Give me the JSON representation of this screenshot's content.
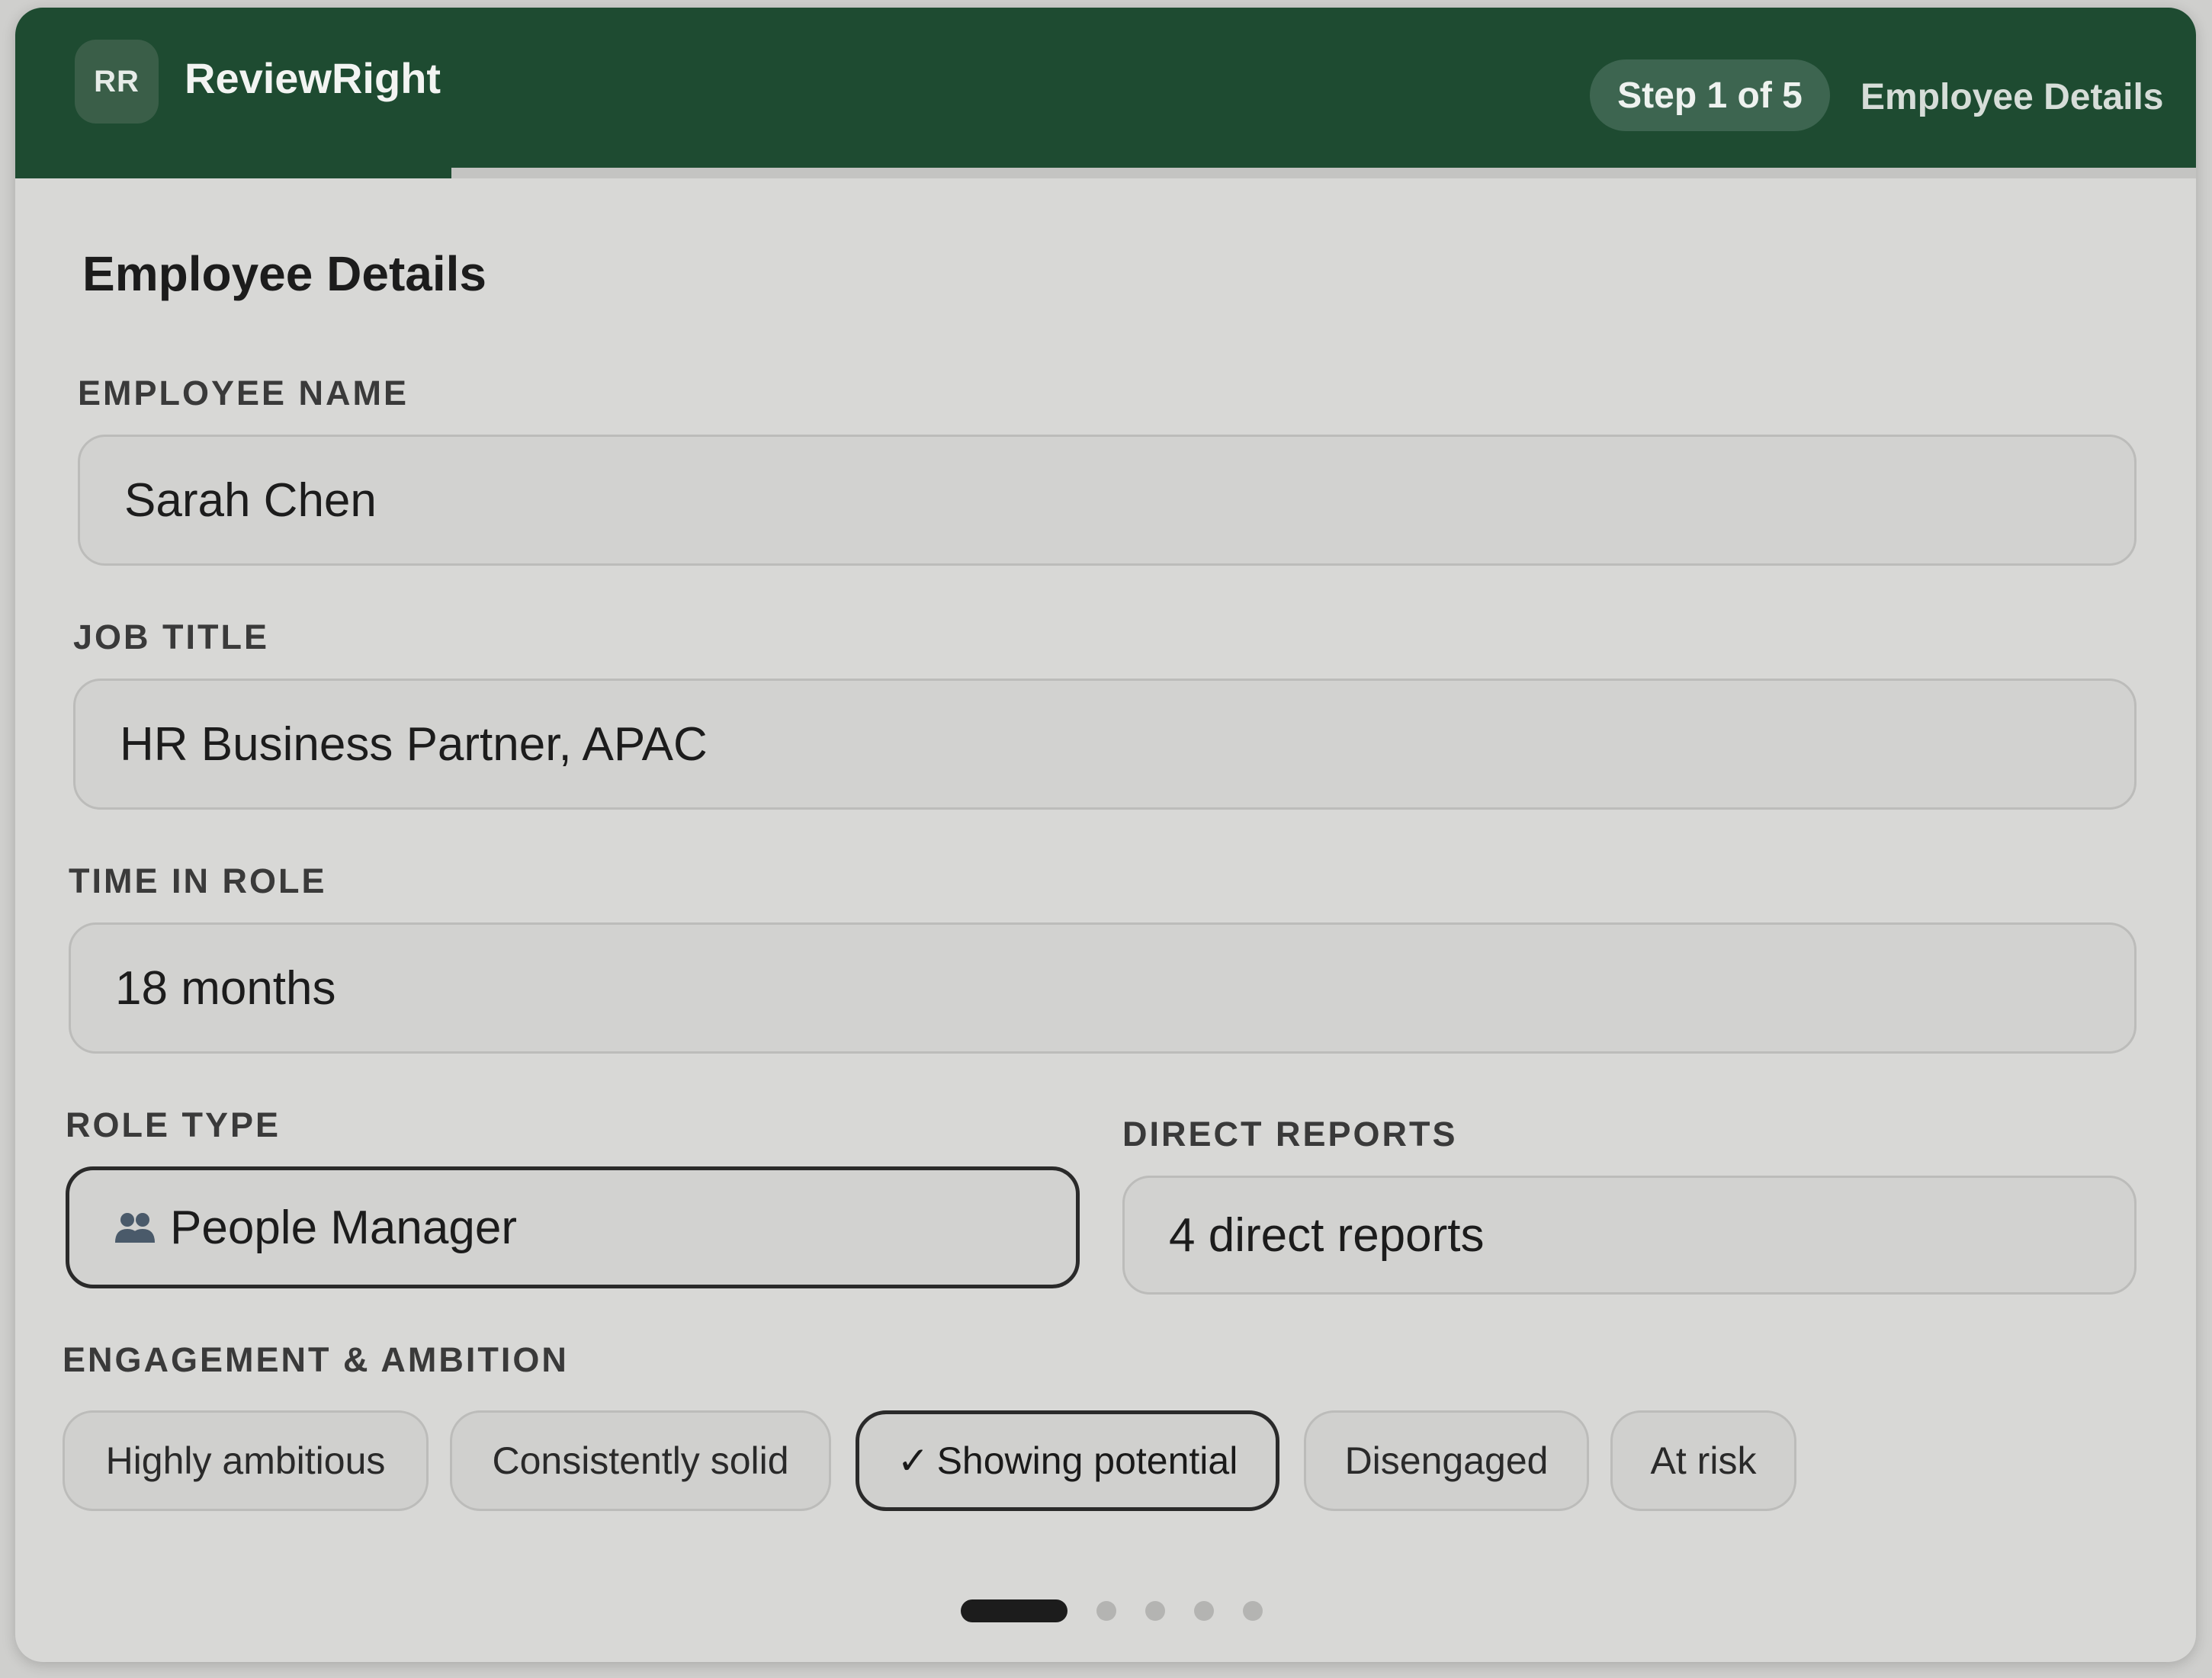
{
  "header": {
    "logo_initials": "RR",
    "app_name": "ReviewRight",
    "step_label": "Step 1 of 5",
    "step_name": "Employee Details",
    "progress_fraction": 0.2,
    "brand_color": "#1e4b31"
  },
  "form": {
    "title": "Employee Details",
    "employee_name": {
      "label": "EMPLOYEE NAME",
      "value": "Sarah Chen"
    },
    "job_title": {
      "label": "JOB TITLE",
      "value": "HR Business Partner, APAC"
    },
    "time_in_role": {
      "label": "TIME IN ROLE",
      "value": "18 months"
    },
    "role_type": {
      "label": "ROLE TYPE",
      "value": "People Manager",
      "icon": "people-icon"
    },
    "direct_reports": {
      "label": "DIRECT REPORTS",
      "value": "4 direct reports"
    },
    "engagement": {
      "label": "ENGAGEMENT & AMBITION",
      "check_glyph": "✓",
      "options": [
        {
          "label": "Highly ambitious"
        },
        {
          "label": "Consistently solid"
        },
        {
          "label": "Showing potential",
          "selected": true
        },
        {
          "label": "Disengaged"
        },
        {
          "label": "At risk"
        }
      ]
    }
  },
  "pagination": {
    "total": 5,
    "current": 1
  }
}
